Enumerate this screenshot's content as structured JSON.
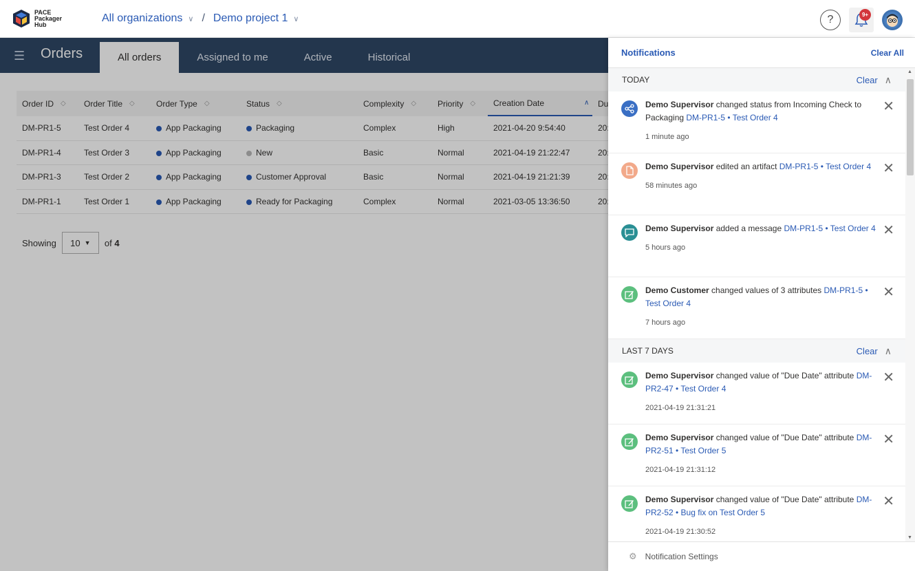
{
  "app": {
    "logo_line1": "PACE",
    "logo_line2": "Packager",
    "logo_line3": "Hub"
  },
  "breadcrumb": {
    "org": "All organizations",
    "separator": "/",
    "project": "Demo project 1"
  },
  "header": {
    "help_icon": "?",
    "badge": "9+"
  },
  "nav": {
    "title": "Orders",
    "tabs": [
      "All orders",
      "Assigned to me",
      "Active",
      "Historical"
    ]
  },
  "table": {
    "columns": [
      "Order ID",
      "Order Title",
      "Order Type",
      "Status",
      "Complexity",
      "Priority",
      "Creation Date",
      "Du"
    ],
    "rows": [
      {
        "id": "DM-PR1-5",
        "title": "Test Order 4",
        "type": "App Packaging",
        "status": "Packaging",
        "status_color": "#2a5ab4",
        "complexity": "Complex",
        "priority": "High",
        "created": "2021-04-20 9:54:40",
        "due": "20:"
      },
      {
        "id": "DM-PR1-4",
        "title": "Test Order 3",
        "type": "App Packaging",
        "status": "New",
        "status_color": "#b8b8b8",
        "complexity": "Basic",
        "priority": "Normal",
        "created": "2021-04-19 21:22:47",
        "due": "20:"
      },
      {
        "id": "DM-PR1-3",
        "title": "Test Order 2",
        "type": "App Packaging",
        "status": "Customer Approval",
        "status_color": "#2a5ab4",
        "complexity": "Basic",
        "priority": "Normal",
        "created": "2021-04-19 21:21:39",
        "due": "20:"
      },
      {
        "id": "DM-PR1-1",
        "title": "Test Order 1",
        "type": "App Packaging",
        "status": "Ready for Packaging",
        "status_color": "#2a5ab4",
        "complexity": "Complex",
        "priority": "Normal",
        "created": "2021-03-05 13:36:50",
        "due": "20:"
      }
    ]
  },
  "pager": {
    "showing": "Showing",
    "page_size": "10",
    "of": "of",
    "total": "4"
  },
  "notifications": {
    "title": "Notifications",
    "clear_all": "Clear All",
    "sections": [
      {
        "label": "TODAY",
        "clear": "Clear",
        "items": [
          {
            "actor": "Demo Supervisor",
            "text": " changed status from Incoming Check to Packaging ",
            "link": "DM-PR1-5 • Test Order 4",
            "time": "1 minute ago",
            "icon": "share-icon",
            "color": "#3a6fc4"
          },
          {
            "actor": "Demo Supervisor",
            "text": " edited an artifact ",
            "link": "DM-PR1-5 • Test Order 4",
            "time": "58 minutes ago",
            "icon": "document-icon",
            "color": "#f2a98a"
          },
          {
            "actor": "Demo Supervisor",
            "text": " added a message ",
            "link": "DM-PR1-5 • Test Order 4",
            "time": "5 hours ago",
            "icon": "message-icon",
            "color": "#2a8f94"
          },
          {
            "actor": "Demo Customer",
            "text": " changed values of 3 attributes ",
            "link": "DM-PR1-5 • Test Order 4",
            "time": "7 hours ago",
            "icon": "edit-icon",
            "color": "#5cbf7e"
          }
        ]
      },
      {
        "label": "LAST 7 DAYS",
        "clear": "Clear",
        "items": [
          {
            "actor": "Demo Supervisor",
            "text": " changed value of \"Due Date\" attribute ",
            "link": "DM-PR2-47 • Test Order 4",
            "time": "2021-04-19 21:31:21",
            "icon": "edit-icon",
            "color": "#5cbf7e"
          },
          {
            "actor": "Demo Supervisor",
            "text": " changed value of \"Due Date\" attribute ",
            "link": "DM-PR2-51 • Test Order 5",
            "time": "2021-04-19 21:31:12",
            "icon": "edit-icon",
            "color": "#5cbf7e"
          },
          {
            "actor": "Demo Supervisor",
            "text": " changed value of \"Due Date\" attribute ",
            "link": "DM-PR2-52 • Bug fix on Test Order 5",
            "time": "2021-04-19 21:30:52",
            "icon": "edit-icon",
            "color": "#5cbf7e"
          }
        ]
      }
    ],
    "footer": "Notification Settings"
  }
}
